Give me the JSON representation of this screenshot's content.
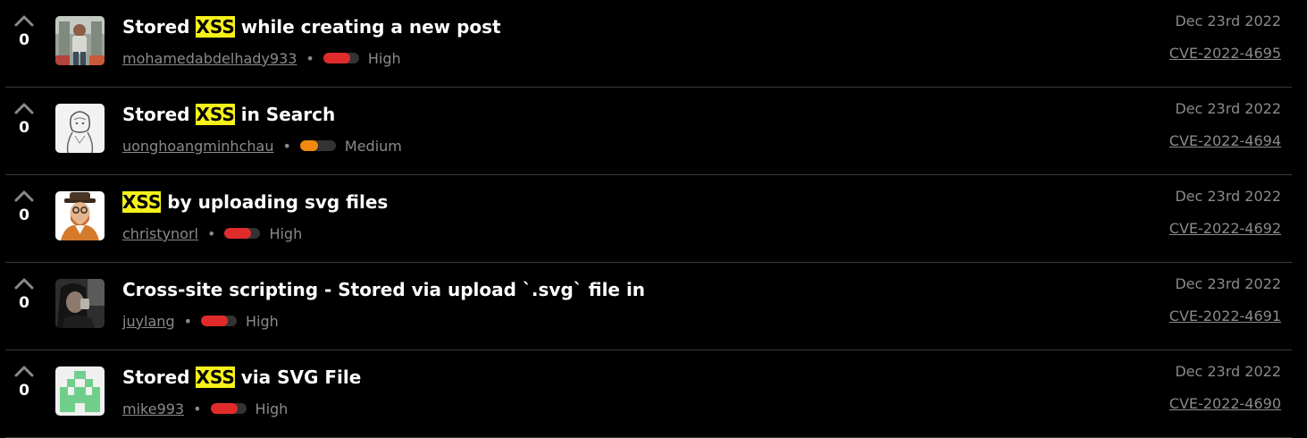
{
  "reports": [
    {
      "votes": "0",
      "title_pre": "Stored ",
      "title_hl": "XSS",
      "title_post": " while creating a new post",
      "user": "mohamedabdelhady933",
      "severity": "High",
      "severity_level": 0.75,
      "severity_color": "#e12b2b",
      "date": "Dec 23rd 2022",
      "cve": "CVE-2022-4695"
    },
    {
      "votes": "0",
      "title_pre": "Stored ",
      "title_hl": "XSS",
      "title_post": " in Search",
      "user": "uonghoangminhchau",
      "severity": "Medium",
      "severity_level": 0.5,
      "severity_color": "#f28a0f",
      "date": "Dec 23rd 2022",
      "cve": "CVE-2022-4694"
    },
    {
      "votes": "0",
      "title_pre": "",
      "title_hl": "XSS",
      "title_post": " by uploading svg files",
      "user": "christynorl",
      "severity": "High",
      "severity_level": 0.75,
      "severity_color": "#e12b2b",
      "date": "Dec 23rd 2022",
      "cve": "CVE-2022-4692"
    },
    {
      "votes": "0",
      "title_pre": "Cross-site scripting - Stored via upload `.svg` file in",
      "title_hl": "",
      "title_post": "",
      "user": "juylang",
      "severity": "High",
      "severity_level": 0.75,
      "severity_color": "#e12b2b",
      "date": "Dec 23rd 2022",
      "cve": "CVE-2022-4691"
    },
    {
      "votes": "0",
      "title_pre": "Stored ",
      "title_hl": "XSS",
      "title_post": " via SVG File",
      "user": "mike993",
      "severity": "High",
      "severity_level": 0.75,
      "severity_color": "#e12b2b",
      "date": "Dec 23rd 2022",
      "cve": "CVE-2022-4690"
    }
  ],
  "icons": {
    "upvote": "chevron-up-icon"
  }
}
